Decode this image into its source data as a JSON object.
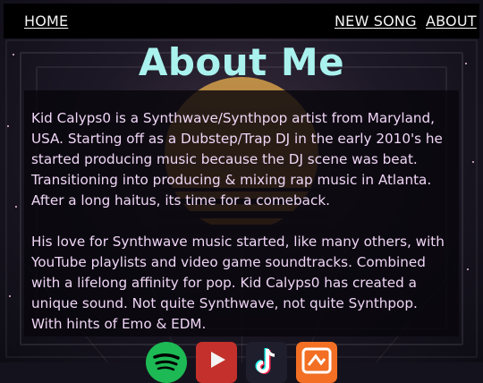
{
  "nav": {
    "home_label": "HOME",
    "new_song_label": "NEW SONG",
    "about_label": "ABOUT"
  },
  "page": {
    "title": "About Me"
  },
  "content": {
    "paragraph_1": "Kid Calyps0 is a Synthwave/Synthpop artist from Maryland, USA. Starting off as a Dubstep/Trap DJ in the early 2010's he started producing music because the DJ scene was beat. Transitioning into producing & mixing rap music in Atlanta. After a long haitus, its time for a comeback.",
    "paragraph_2": "His love for Synthwave music started, like many others, with YouTube playlists and video game soundtracks. Combined with a lifelong affinity for pop. Kid Calyps0 has created a unique sound. Not quite Synthwave, not quite Synthpop. With hints of Emo & EDM."
  },
  "social_icons": [
    {
      "name": "spotify-icon",
      "color": "#1db954"
    },
    {
      "name": "youtube-icon",
      "color": "#c4302b"
    },
    {
      "name": "tiktok-icon",
      "color": "#1e1e2c"
    },
    {
      "name": "soundcloud-icon",
      "color": "#f26f23"
    }
  ],
  "colors": {
    "title": "#a9f2ee",
    "body_text": "#f0d6f6",
    "nav_background": "#000000",
    "nav_text": "#f4f4f4"
  }
}
